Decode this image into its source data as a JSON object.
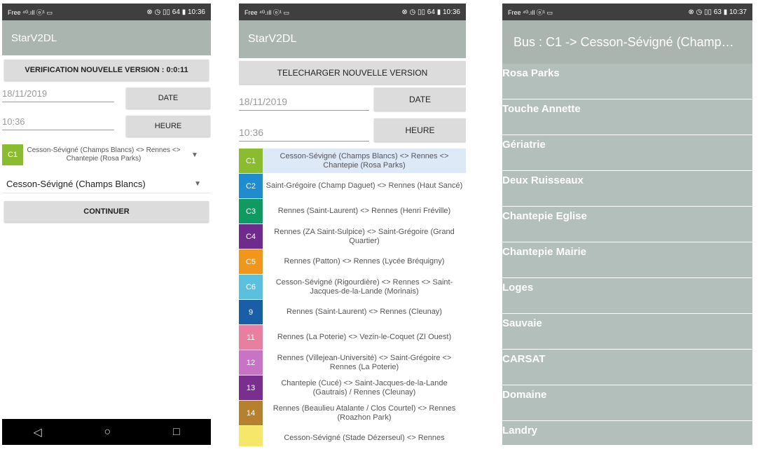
{
  "phone1": {
    "status_left": "Free ⁴ᴳ.ıll ⓞ¹ ▭",
    "status_right": "⊗ ◷ ▯▯ 64 ▮ 10:36",
    "app_title": "StarV2DL",
    "verify_button": "VERIFICATION NOUVELLE VERSION : 0:0:11",
    "date_value": "18/11/2019",
    "date_button": "DATE",
    "time_value": "10:36",
    "time_button": "HEURE",
    "line": {
      "code": "C1",
      "text": "Cesson-Sévigné (Champs Blancs) <> Rennes <> Chantepie (Rosa Parks)",
      "color": "#8bbb2e"
    },
    "stop_selected": "Cesson-Sévigné (Champs Blancs)",
    "continue_button": "CONTINUER",
    "nav": {
      "back": "◁",
      "home": "○",
      "recent": "□"
    }
  },
  "phone2": {
    "status_left": "Free ⁴ᴳ.ıll ⓞ¹ ▭",
    "status_right": "⊗ ◷ ▯▯ 64 ▮ 10:36",
    "app_title": "StarV2DL",
    "download_button": "TELECHARGER NOUVELLE VERSION",
    "date_value": "18/11/2019",
    "date_button": "DATE",
    "time_value": "10:36",
    "time_button": "HEURE",
    "lines": [
      {
        "code": "C1",
        "text": "Cesson-Sévigné (Champs Blancs) <> Rennes <> Chantepie (Rosa Parks)",
        "color": "#8bbb2e"
      },
      {
        "code": "C2",
        "text": "Saint-Grégoire (Champ Daguet) <> Rennes (Haut Sancé)",
        "color": "#1e8ccf"
      },
      {
        "code": "C3",
        "text": "Rennes (Saint-Laurent) <> Rennes (Henri Fréville)",
        "color": "#0f9a62"
      },
      {
        "code": "C4",
        "text": "Rennes (ZA Saint-Sulpice) <> Saint-Grégoire (Grand Quartier)",
        "color": "#6e2a8c"
      },
      {
        "code": "C5",
        "text": "Rennes (Patton) <> Rennes (Lycée Bréquigny)",
        "color": "#f0961c"
      },
      {
        "code": "C6",
        "text": "Cesson-Sévigné (Rigourdière) <> Rennes <> Saint-Jacques-de-la-Lande (Morinais)",
        "color": "#5bc0de"
      },
      {
        "code": "9",
        "text": "Rennes (Saint-Laurent) <> Rennes (Cleunay)",
        "color": "#1b5ea8"
      },
      {
        "code": "11",
        "text": "Rennes (La Poterie) <> Vezin-le-Coquet (ZI Ouest)",
        "color": "#e87fa1"
      },
      {
        "code": "12",
        "text": "Rennes (Villejean-Université) <> Saint-Grégoire <> Rennes (La Poterie)",
        "color": "#c874c5"
      },
      {
        "code": "13",
        "text": "Chantepie (Cucé) <> Saint-Jacques-de-la-Lande (Gautrais) / Rennes (Cleunay)",
        "color": "#7a2f8e"
      },
      {
        "code": "14",
        "text": "Rennes (Beaulieu Atalante / Clos Courtel) <> Rennes (Roazhon Park)",
        "color": "#b7802e"
      },
      {
        "code": "",
        "text": "Cesson-Sévigné (Stade Dézerseul) <> Rennes",
        "color": "#f5e769"
      }
    ]
  },
  "phone3": {
    "status_left": "Free ⁴ᴳ.ıll ⓞ¹ ▭",
    "status_right": "⊗ ◷ ▯▯ 63 ▮ 10:37",
    "app_title": "Bus : C1 -> Cesson-Sévigné (Champ…",
    "stops": [
      "Rosa Parks",
      "Touche Annette",
      "Gériatrie",
      "Deux Ruisseaux",
      "Chantepie Eglise",
      "Chantepie Mairie",
      "Loges",
      "Sauvaie",
      "CARSAT",
      "Domaine",
      "Landry"
    ]
  }
}
